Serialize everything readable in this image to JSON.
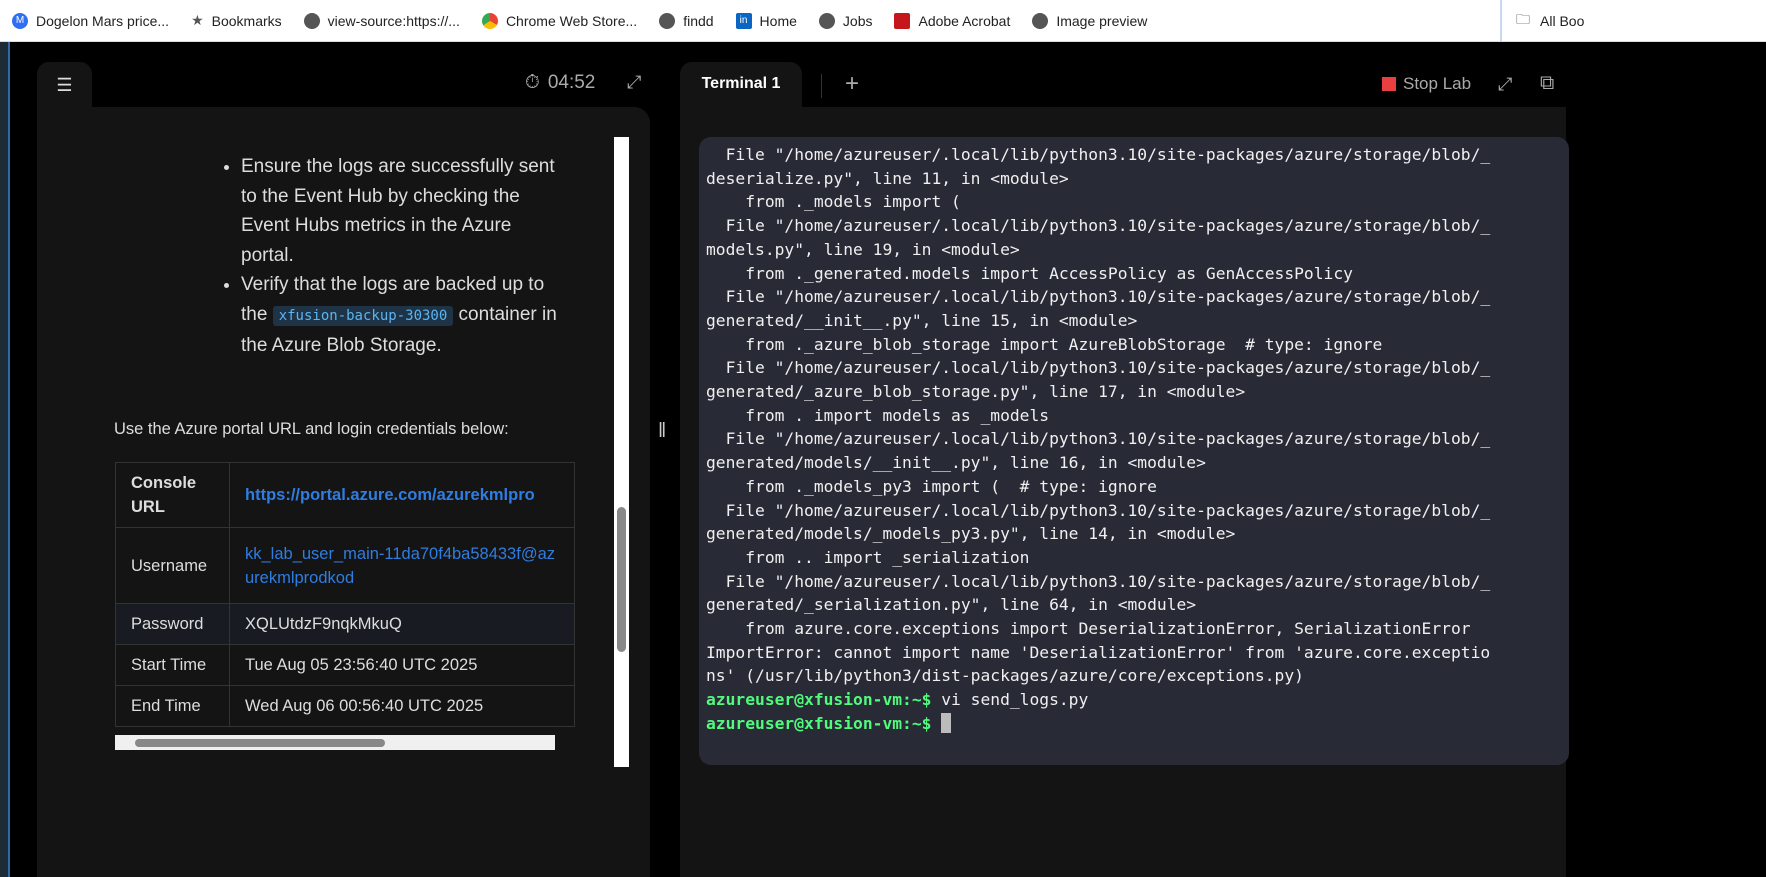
{
  "bookmarks": [
    "Dogelon Mars price...",
    "Bookmarks",
    "view-source:https://...",
    "Chrome Web Store...",
    "findd",
    "Home",
    "Jobs",
    "Adobe Acrobat",
    "Image preview"
  ],
  "all_bookmarks": "All Boo",
  "left": {
    "timer": "04:52",
    "bullets": [
      "Ensure the logs are successfully sent to the Event Hub by checking the Event Hubs metrics in the Azure portal."
    ],
    "bullet2_pre": "Verify that the logs are backed up to the ",
    "bullet2_code": "xfusion-backup-30300",
    "bullet2_post": " container in the Azure Blob Storage.",
    "intro": "Use the Azure portal URL and login credentials below:",
    "table": [
      {
        "k": "Console URL",
        "v": "https://portal.azure.com/azurekmlpro"
      },
      {
        "k": "Username",
        "v": "kk_lab_user_main-11da70f4ba58433f@azurekmlprodkod"
      },
      {
        "k": "Password",
        "v": "XQLUtdzF9nqkMkuQ"
      },
      {
        "k": "Start Time",
        "v": "Tue Aug 05 23:56:40 UTC 2025"
      },
      {
        "k": "End Time",
        "v": "Wed Aug 06 00:56:40 UTC 2025"
      }
    ]
  },
  "right": {
    "tab": "Terminal 1",
    "add": "+",
    "stop": "Stop Lab",
    "lines": [
      "  File \"/home/azureuser/.local/lib/python3.10/site-packages/azure/storage/blob/_",
      "deserialize.py\", line 11, in <module>",
      "    from ._models import (",
      "  File \"/home/azureuser/.local/lib/python3.10/site-packages/azure/storage/blob/_",
      "models.py\", line 19, in <module>",
      "    from ._generated.models import AccessPolicy as GenAccessPolicy",
      "  File \"/home/azureuser/.local/lib/python3.10/site-packages/azure/storage/blob/_",
      "generated/__init__.py\", line 15, in <module>",
      "    from ._azure_blob_storage import AzureBlobStorage  # type: ignore",
      "  File \"/home/azureuser/.local/lib/python3.10/site-packages/azure/storage/blob/_",
      "generated/_azure_blob_storage.py\", line 17, in <module>",
      "    from . import models as _models",
      "  File \"/home/azureuser/.local/lib/python3.10/site-packages/azure/storage/blob/_",
      "generated/models/__init__.py\", line 16, in <module>",
      "    from ._models_py3 import (  # type: ignore",
      "  File \"/home/azureuser/.local/lib/python3.10/site-packages/azure/storage/blob/_",
      "generated/models/_models_py3.py\", line 14, in <module>",
      "    from .. import _serialization",
      "  File \"/home/azureuser/.local/lib/python3.10/site-packages/azure/storage/blob/_",
      "generated/_serialization.py\", line 64, in <module>",
      "    from azure.core.exceptions import DeserializationError, SerializationError",
      "ImportError: cannot import name 'DeserializationError' from 'azure.core.exceptio",
      "ns' (/usr/lib/python3/dist-packages/azure/core/exceptions.py)"
    ],
    "prompt": "azureuser@xfusion-vm:~$",
    "cmd1": " vi send_logs.py",
    "cmd2": " "
  }
}
